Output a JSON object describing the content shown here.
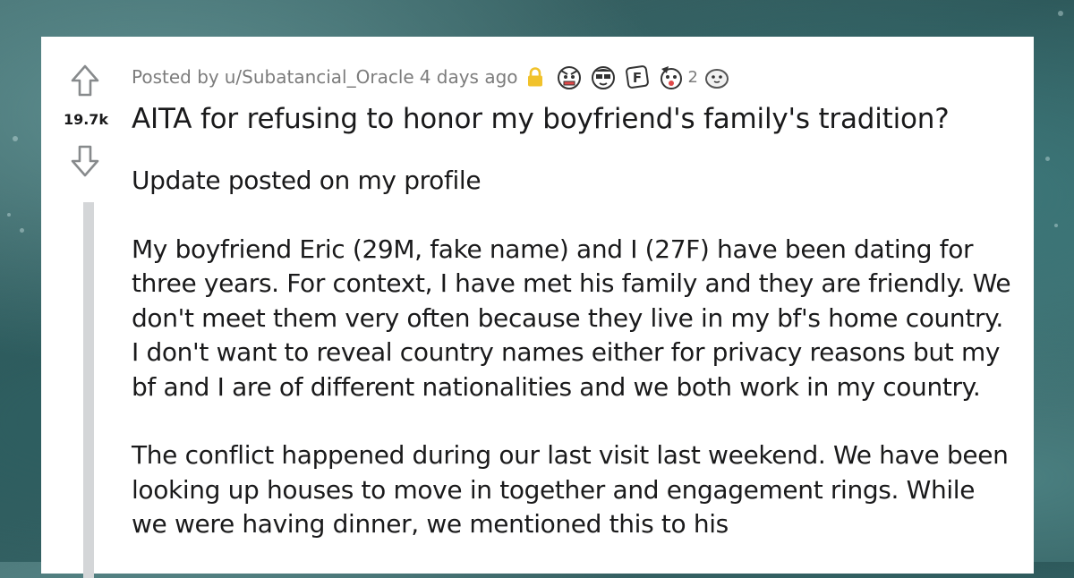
{
  "post": {
    "posted_by_prefix": "Posted by",
    "author": "u/Subatancial_Oracle",
    "time_ago": "4 days ago",
    "vote_count": "19.7k",
    "title": "AITA for refusing to honor my boyfriend's family's tradition?",
    "award_count": "2",
    "awards": [
      "angry-face-award",
      "sunglasses-face-award",
      "press-f-award",
      "party-face-award",
      "wholesome-seal-award"
    ],
    "icons": {
      "upvote": "upvote-arrow-icon",
      "downvote": "downvote-arrow-icon",
      "lock": "lock-icon"
    },
    "colors": {
      "text": "#1a1a1b",
      "meta": "#7c7c7c",
      "lock": "#f1c22b",
      "vote_icon": "#878a8c",
      "thread_line": "#d4d6d8"
    },
    "paragraphs": [
      "Update posted on my profile",
      "My boyfriend Eric (29M, fake name) and I (27F) have been dating for three years. For context, I have met his family and they are friendly. We don't meet them very often because they live in my bf's home country. I don't want to reveal country names either for privacy reasons but my bf and I are of different nationalities and we both work in my country.",
      "The conflict happened during our last visit last weekend. We have been looking up houses to move in together and engagement rings. While we were having dinner, we mentioned this to his"
    ]
  }
}
